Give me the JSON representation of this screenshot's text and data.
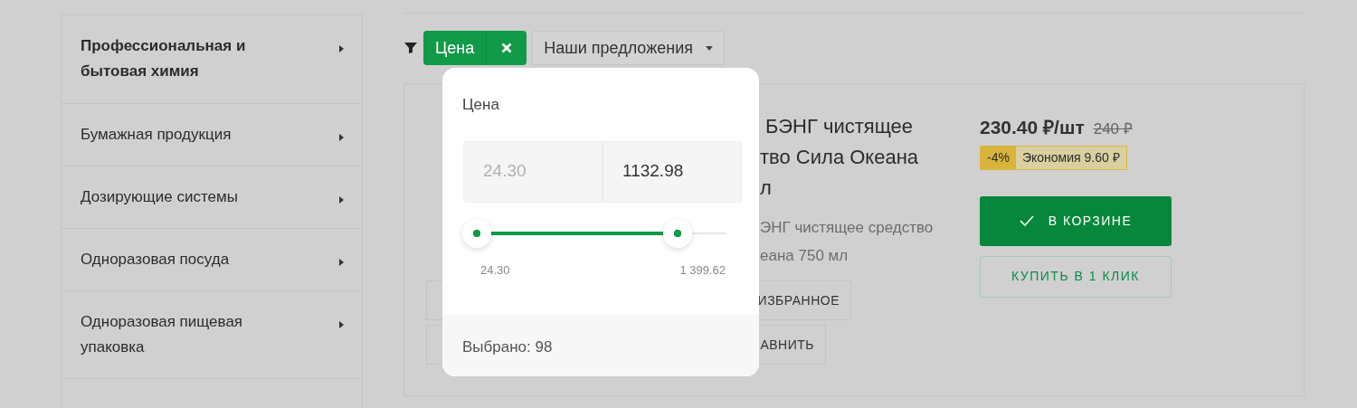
{
  "sidebar": {
    "items": [
      {
        "label": "Профессиональная и бытовая химия",
        "selected": true
      },
      {
        "label": "Бумажная продукция",
        "selected": false
      },
      {
        "label": "Дозирующие системы",
        "selected": false
      },
      {
        "label": "Одноразовая посуда",
        "selected": false
      },
      {
        "label": "Одноразовая пищевая упаковка",
        "selected": false
      }
    ]
  },
  "filter_bar": {
    "active_filter": {
      "label": "Цена"
    },
    "sort_dropdown": {
      "label": "Наши предложения"
    }
  },
  "price_popup": {
    "title": "Цена",
    "min_field": {
      "placeholder": "24.30"
    },
    "max_field": {
      "value": "1132.98"
    },
    "slider": {
      "thumbs": [
        {
          "level": 0
        },
        {
          "level": 0.806
        }
      ],
      "min_label": "24.30",
      "max_label": "1 399.62"
    },
    "footer": "Выбрано: 98"
  },
  "product": {
    "title_lines": [
      "БЭНГ чистящее",
      "тво Сила Океана",
      "л"
    ],
    "description_lines": [
      "ЭНГ чистящее средство",
      "еана 750 мл"
    ],
    "favorite_button": "ИЗБРАННОЕ",
    "compare_button": "АВНИТЬ",
    "price": "230.40 ₽/шт",
    "old_price": "240 ₽",
    "discount": "-4%",
    "savings": "Экономия 9.60 ₽",
    "cart_button": {
      "label": "В КОРЗИНЕ",
      "in_cart": true
    },
    "one_click_button": "КУПИТЬ В 1 КЛИК"
  }
}
